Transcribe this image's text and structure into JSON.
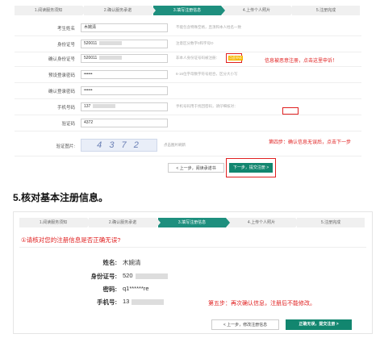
{
  "top": {
    "steps": [
      "1.阅读服务须知",
      "2.确认服务承诺",
      "3.填写注册信息",
      "4.上传个人照片",
      "5.注册完成"
    ],
    "active_step": 2,
    "fields": [
      {
        "label": "考生姓名",
        "value": "木婉清",
        "hint": "不能包含特殊空格，且须和本人姓名一致"
      },
      {
        "label": "身份证号",
        "value": "520011",
        "hint": "注意区分数字0和字母O"
      },
      {
        "label": "确认身份证号",
        "value": "520011",
        "hint": "非本人身份证号码被注册："
      },
      {
        "label": "预设登录密码",
        "value": "••••••",
        "hint": "6-16位字母数字符号组合，区分大小写"
      },
      {
        "label": "确认登录密码",
        "value": "••••••",
        "hint": ""
      },
      {
        "label": "手机号码",
        "value": "137",
        "hint": "手机号码用于找回密码，请仔细核对："
      },
      {
        "label": "验证码",
        "value": "4372",
        "hint": ""
      }
    ],
    "captcha_label": "验证图片:",
    "captcha_text": "4 3 7 2",
    "captcha_hint": "点击图片刷新",
    "appeal_link": "点此申诉",
    "note_appeal": "信息被恶意注册，点击这里申诉！",
    "note_step4": "第四步：确认信息无误后，点击下一步",
    "btn_prev": "< 上一步，阅读承诺书",
    "btn_next": "下一步，提交注册 >"
  },
  "section_title": "5.核对基本注册信息。",
  "bottom": {
    "steps": [
      "1.阅读服务须知",
      "2.确认服务承诺",
      "3.填写注册信息",
      "4.上传个人照片",
      "5.注册完成"
    ],
    "active_step": 2,
    "question": "①请核对您的注册信息是否正确无误?",
    "rows": [
      {
        "key": "姓名:",
        "value": "木婉清"
      },
      {
        "key": "身份证号:",
        "value": "520"
      },
      {
        "key": "密码:",
        "value": "q1******re"
      },
      {
        "key": "手机号:",
        "value": "13"
      }
    ],
    "note_step5": "第五步：再次确认信息，注册后不能修改。",
    "btn_prev": "< 上一步，修改注册信息",
    "btn_submit": "正确无误，提交注册 >"
  },
  "colors": {
    "accent": "#1e8f7e",
    "red": "#e02020"
  }
}
